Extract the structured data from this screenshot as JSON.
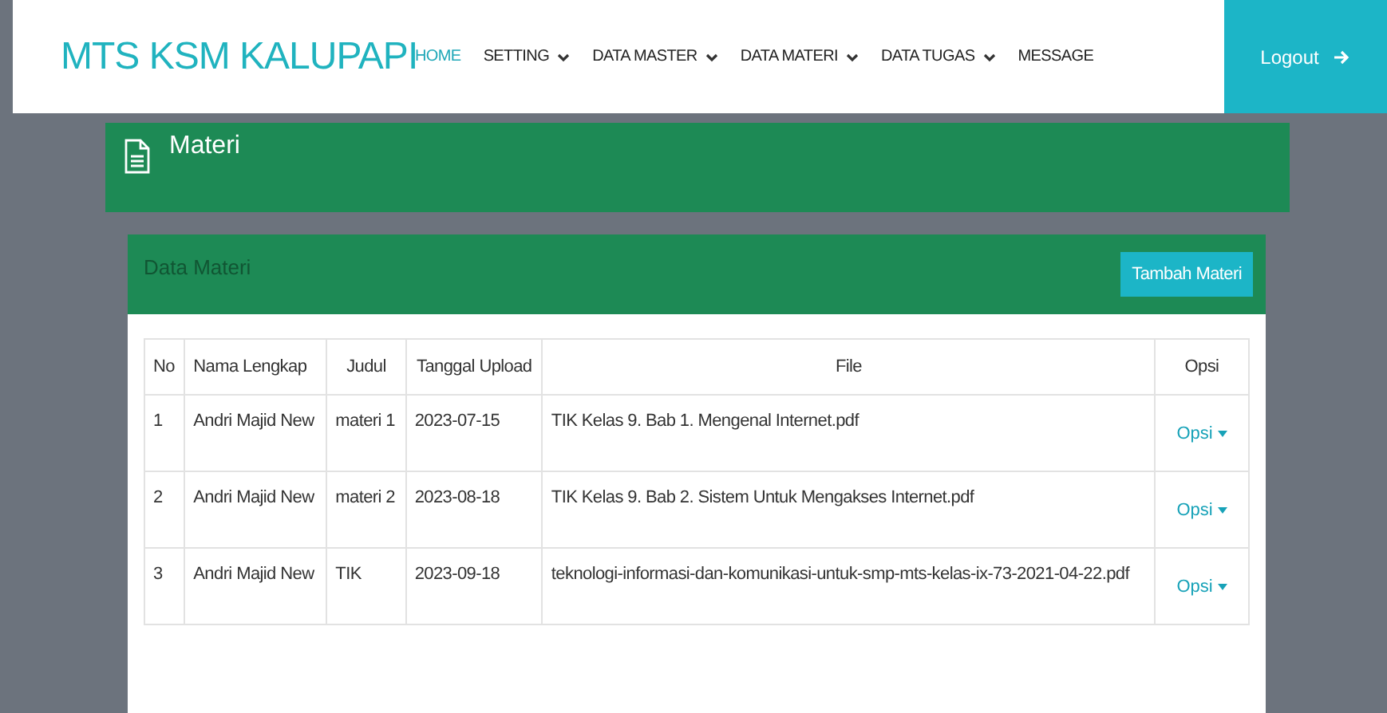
{
  "brand": "MTS KSM KALUPAPI",
  "nav": [
    {
      "label": "HOME",
      "selected": true,
      "dropdown": false
    },
    {
      "label": "SETTING",
      "selected": false,
      "dropdown": true
    },
    {
      "label": "DATA MASTER",
      "selected": false,
      "dropdown": true
    },
    {
      "label": "DATA MATERI",
      "selected": false,
      "dropdown": true
    },
    {
      "label": "DATA TUGAS",
      "selected": false,
      "dropdown": true
    },
    {
      "label": "MESSAGE",
      "selected": false,
      "dropdown": false
    }
  ],
  "logout": "Logout",
  "page_title": "Materi",
  "card": {
    "title": "Data Materi",
    "add_button": "Tambah Materi"
  },
  "table": {
    "columns": [
      "No",
      "Nama Lengkap",
      "Judul",
      "Tanggal Upload",
      "File",
      "Opsi"
    ],
    "rows": [
      {
        "no": "1",
        "name": "Andri Majid New",
        "title": "materi 1",
        "date": "2023-07-15",
        "file": "TIK Kelas 9. Bab 1. Mengenal Internet.pdf",
        "action": "Opsi"
      },
      {
        "no": "2",
        "name": "Andri Majid New",
        "title": "materi 2",
        "date": "2023-08-18",
        "file": "TIK Kelas 9. Bab 2. Sistem Untuk Mengakses Internet.pdf",
        "action": "Opsi"
      },
      {
        "no": "3",
        "name": "Andri Majid New",
        "title": "TIK",
        "date": "2023-09-18",
        "file": "teknologi-informasi-dan-komunikasi-untuk-smp-mts-kelas-ix-73-2021-04-22.pdf",
        "action": "Opsi"
      }
    ]
  }
}
